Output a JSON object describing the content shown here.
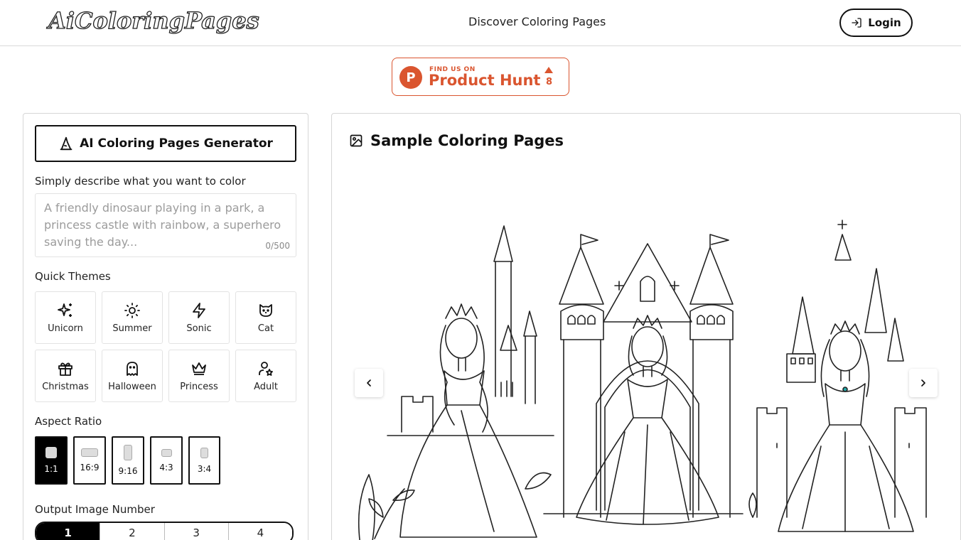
{
  "header": {
    "logo": "AiColoringPages",
    "nav_link": "Discover Coloring Pages",
    "login_label": "Login"
  },
  "product_hunt": {
    "small": "FIND US ON",
    "big": "Product Hunt",
    "count": "8",
    "color": "#da552f"
  },
  "generator": {
    "title": "AI Coloring Pages Generator",
    "prompt_label": "Simply describe what you want to color",
    "prompt_placeholder": "A friendly dinosaur playing in a park, a princess castle with rainbow, a superhero saving the day...",
    "char_counter": "0/500",
    "themes_label": "Quick Themes",
    "themes": [
      {
        "label": "Unicorn",
        "icon": "sparkles-icon"
      },
      {
        "label": "Summer",
        "icon": "sun-icon"
      },
      {
        "label": "Sonic",
        "icon": "lightning-icon"
      },
      {
        "label": "Cat",
        "icon": "cat-icon"
      },
      {
        "label": "Christmas",
        "icon": "gift-icon"
      },
      {
        "label": "Halloween",
        "icon": "ghost-icon"
      },
      {
        "label": "Princess",
        "icon": "crown-icon"
      },
      {
        "label": "Adult",
        "icon": "user-star-icon"
      }
    ],
    "aspect_label": "Aspect Ratio",
    "aspect_ratios": [
      {
        "label": "1:1",
        "selected": true
      },
      {
        "label": "16:9",
        "selected": false
      },
      {
        "label": "9:16",
        "selected": false
      },
      {
        "label": "4:3",
        "selected": false
      },
      {
        "label": "3:4",
        "selected": false
      }
    ],
    "output_label": "Output Image Number",
    "output_numbers": [
      {
        "label": "1",
        "selected": true
      },
      {
        "label": "2",
        "selected": false
      },
      {
        "label": "3",
        "selected": false
      },
      {
        "label": "4",
        "selected": false
      }
    ]
  },
  "samples": {
    "title": "Sample Coloring Pages",
    "image_icon": "image-icon",
    "prev_icon": "chevron-left-icon",
    "next_icon": "chevron-right-icon"
  }
}
